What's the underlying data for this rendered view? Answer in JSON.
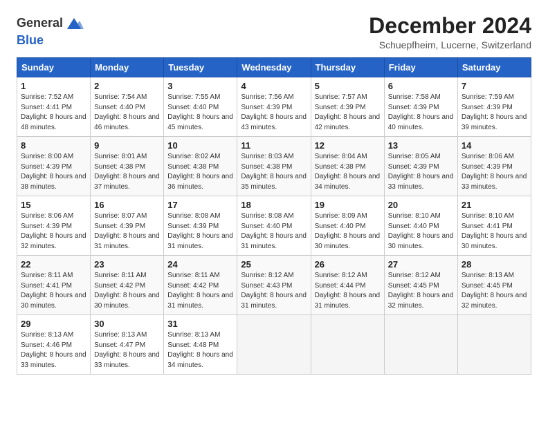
{
  "header": {
    "logo_line1": "General",
    "logo_line2": "Blue",
    "title": "December 2024",
    "subtitle": "Schuepfheim, Lucerne, Switzerland"
  },
  "days_of_week": [
    "Sunday",
    "Monday",
    "Tuesday",
    "Wednesday",
    "Thursday",
    "Friday",
    "Saturday"
  ],
  "weeks": [
    [
      {
        "day": 1,
        "sunrise": "7:52 AM",
        "sunset": "4:41 PM",
        "daylight": "8 hours and 48 minutes."
      },
      {
        "day": 2,
        "sunrise": "7:54 AM",
        "sunset": "4:40 PM",
        "daylight": "8 hours and 46 minutes."
      },
      {
        "day": 3,
        "sunrise": "7:55 AM",
        "sunset": "4:40 PM",
        "daylight": "8 hours and 45 minutes."
      },
      {
        "day": 4,
        "sunrise": "7:56 AM",
        "sunset": "4:39 PM",
        "daylight": "8 hours and 43 minutes."
      },
      {
        "day": 5,
        "sunrise": "7:57 AM",
        "sunset": "4:39 PM",
        "daylight": "8 hours and 42 minutes."
      },
      {
        "day": 6,
        "sunrise": "7:58 AM",
        "sunset": "4:39 PM",
        "daylight": "8 hours and 40 minutes."
      },
      {
        "day": 7,
        "sunrise": "7:59 AM",
        "sunset": "4:39 PM",
        "daylight": "8 hours and 39 minutes."
      }
    ],
    [
      {
        "day": 8,
        "sunrise": "8:00 AM",
        "sunset": "4:39 PM",
        "daylight": "8 hours and 38 minutes."
      },
      {
        "day": 9,
        "sunrise": "8:01 AM",
        "sunset": "4:38 PM",
        "daylight": "8 hours and 37 minutes."
      },
      {
        "day": 10,
        "sunrise": "8:02 AM",
        "sunset": "4:38 PM",
        "daylight": "8 hours and 36 minutes."
      },
      {
        "day": 11,
        "sunrise": "8:03 AM",
        "sunset": "4:38 PM",
        "daylight": "8 hours and 35 minutes."
      },
      {
        "day": 12,
        "sunrise": "8:04 AM",
        "sunset": "4:38 PM",
        "daylight": "8 hours and 34 minutes."
      },
      {
        "day": 13,
        "sunrise": "8:05 AM",
        "sunset": "4:39 PM",
        "daylight": "8 hours and 33 minutes."
      },
      {
        "day": 14,
        "sunrise": "8:06 AM",
        "sunset": "4:39 PM",
        "daylight": "8 hours and 33 minutes."
      }
    ],
    [
      {
        "day": 15,
        "sunrise": "8:06 AM",
        "sunset": "4:39 PM",
        "daylight": "8 hours and 32 minutes."
      },
      {
        "day": 16,
        "sunrise": "8:07 AM",
        "sunset": "4:39 PM",
        "daylight": "8 hours and 31 minutes."
      },
      {
        "day": 17,
        "sunrise": "8:08 AM",
        "sunset": "4:39 PM",
        "daylight": "8 hours and 31 minutes."
      },
      {
        "day": 18,
        "sunrise": "8:08 AM",
        "sunset": "4:40 PM",
        "daylight": "8 hours and 31 minutes."
      },
      {
        "day": 19,
        "sunrise": "8:09 AM",
        "sunset": "4:40 PM",
        "daylight": "8 hours and 30 minutes."
      },
      {
        "day": 20,
        "sunrise": "8:10 AM",
        "sunset": "4:40 PM",
        "daylight": "8 hours and 30 minutes."
      },
      {
        "day": 21,
        "sunrise": "8:10 AM",
        "sunset": "4:41 PM",
        "daylight": "8 hours and 30 minutes."
      }
    ],
    [
      {
        "day": 22,
        "sunrise": "8:11 AM",
        "sunset": "4:41 PM",
        "daylight": "8 hours and 30 minutes."
      },
      {
        "day": 23,
        "sunrise": "8:11 AM",
        "sunset": "4:42 PM",
        "daylight": "8 hours and 30 minutes."
      },
      {
        "day": 24,
        "sunrise": "8:11 AM",
        "sunset": "4:42 PM",
        "daylight": "8 hours and 31 minutes."
      },
      {
        "day": 25,
        "sunrise": "8:12 AM",
        "sunset": "4:43 PM",
        "daylight": "8 hours and 31 minutes."
      },
      {
        "day": 26,
        "sunrise": "8:12 AM",
        "sunset": "4:44 PM",
        "daylight": "8 hours and 31 minutes."
      },
      {
        "day": 27,
        "sunrise": "8:12 AM",
        "sunset": "4:45 PM",
        "daylight": "8 hours and 32 minutes."
      },
      {
        "day": 28,
        "sunrise": "8:13 AM",
        "sunset": "4:45 PM",
        "daylight": "8 hours and 32 minutes."
      }
    ],
    [
      {
        "day": 29,
        "sunrise": "8:13 AM",
        "sunset": "4:46 PM",
        "daylight": "8 hours and 33 minutes."
      },
      {
        "day": 30,
        "sunrise": "8:13 AM",
        "sunset": "4:47 PM",
        "daylight": "8 hours and 33 minutes."
      },
      {
        "day": 31,
        "sunrise": "8:13 AM",
        "sunset": "4:48 PM",
        "daylight": "8 hours and 34 minutes."
      },
      null,
      null,
      null,
      null
    ]
  ]
}
